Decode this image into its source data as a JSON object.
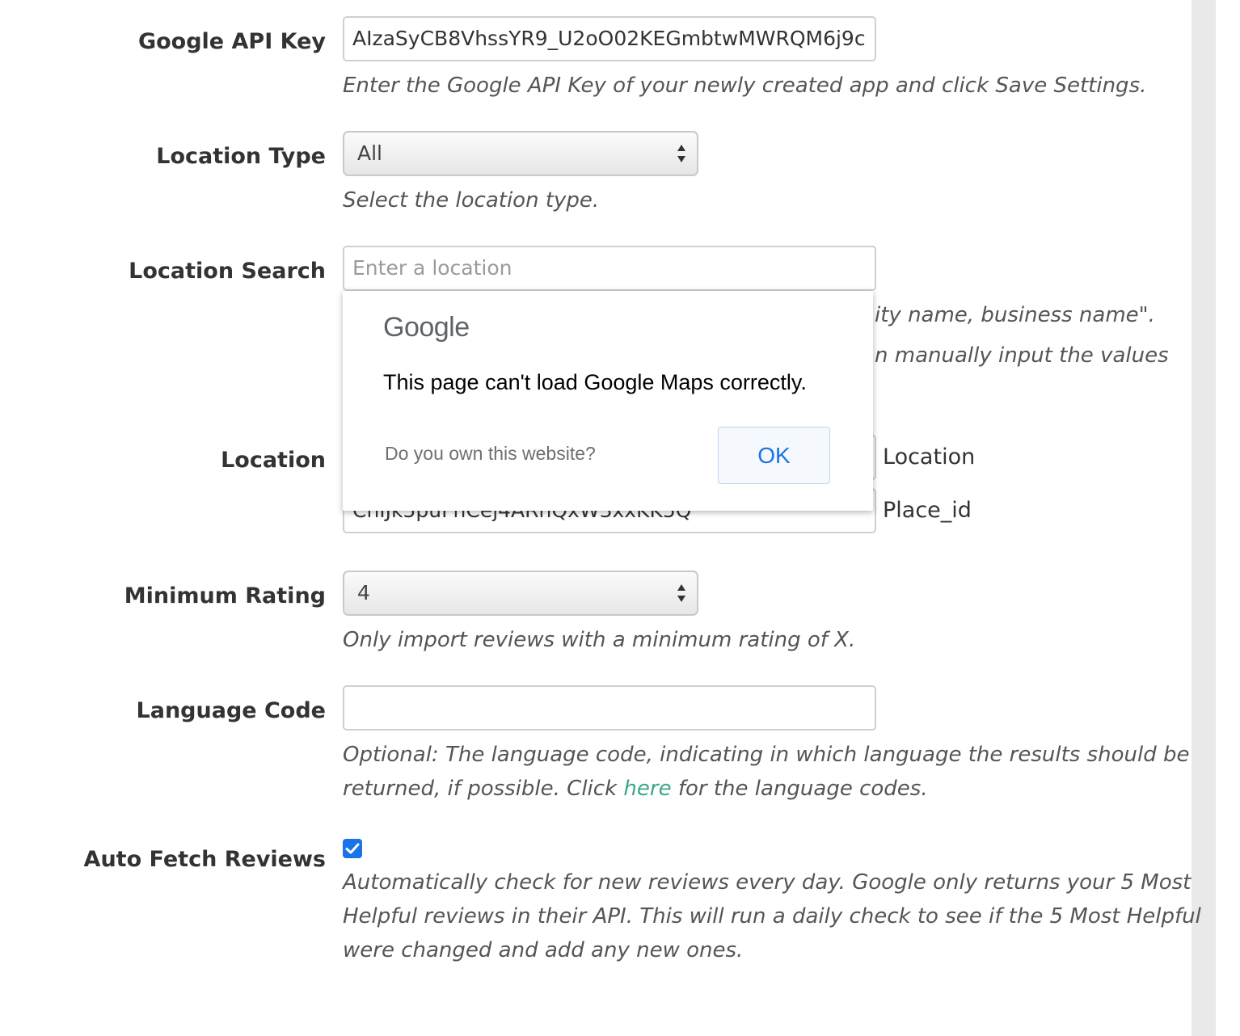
{
  "fields": {
    "api_key": {
      "label": "Google API Key",
      "value": "AIzaSyCB8VhssYR9_U2oO02KEGmbtwMWRQM6j9c",
      "help": "Enter the Google API Key of your newly created app and click Save Settings."
    },
    "location_type": {
      "label": "Location Type",
      "selected": "All",
      "help": "Select the location type."
    },
    "location_search": {
      "label": "Location Search",
      "placeholder": "Enter a location",
      "help_line1_partial": "ity name, business name\".",
      "help_line2_partial": "n manually input the values"
    },
    "location": {
      "label": "Location",
      "location_suffix": "Location",
      "place_id_value": "ChIJk5puFhCej4ARhQxW3xxKK5Q",
      "place_id_suffix": "Place_id"
    },
    "minimum_rating": {
      "label": "Minimum Rating",
      "selected": "4",
      "help": "Only import reviews with a minimum rating of X."
    },
    "language_code": {
      "label": "Language Code",
      "value": "",
      "help_line1": "Optional: The language code, indicating in which language the results should be",
      "help_line2_before": "returned, if possible. Click ",
      "help_link": "here",
      "help_line2_after": " for the language codes."
    },
    "auto_fetch": {
      "label": "Auto Fetch Reviews",
      "checked": true,
      "help_line1": "Automatically check for new reviews every day. Google only returns your 5 Most",
      "help_line2": "Helpful reviews in their API. This will run a daily check to see if the 5 Most Helpful",
      "help_line3": "were changed and add any new ones."
    }
  },
  "maps_error_dialog": {
    "logo_text": "Google",
    "message": "This page can't load Google Maps correctly.",
    "own_website_question": "Do you own this website?",
    "ok_label": "OK"
  },
  "colors": {
    "link": "#3aa68a",
    "checkbox": "#1a73e8",
    "ok_text": "#1a73e8"
  },
  "icons": {
    "select_arrows": "updown-arrows-icon",
    "checkbox_check": "checkmark-icon"
  }
}
